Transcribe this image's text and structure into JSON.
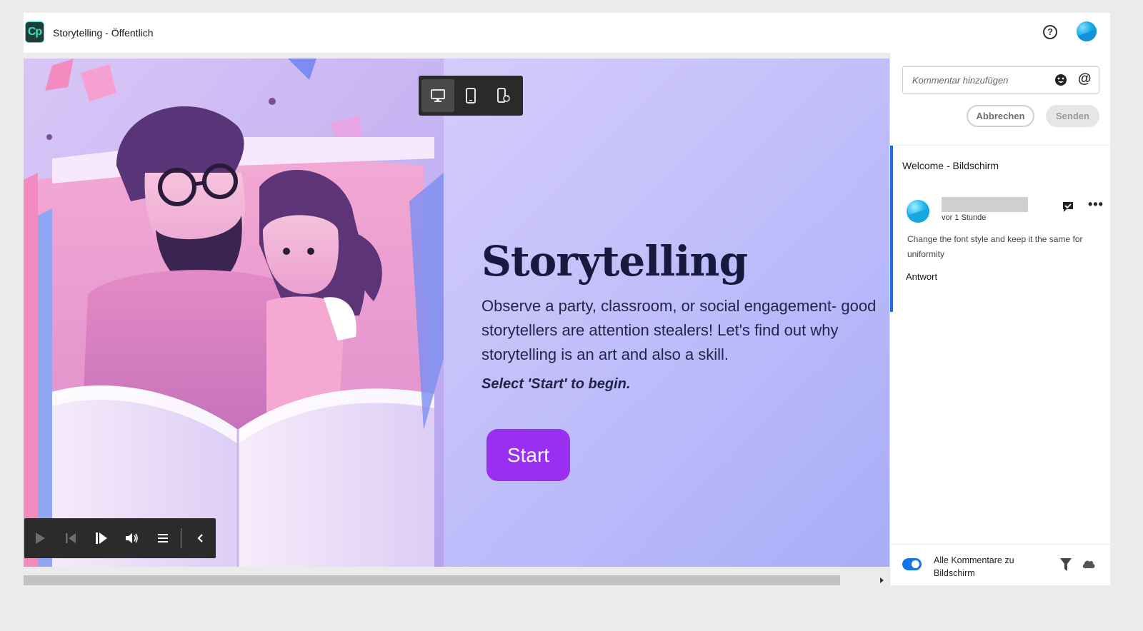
{
  "app": {
    "logo_text": "Cp",
    "title": "Storytelling - Öffentlich"
  },
  "header": {
    "help_label": "?"
  },
  "slide": {
    "title": "Storytelling",
    "body": "Observe a party, classroom, or social engagement- good storytellers are attention stealers! Let's find out why storytelling is an art and also a skill.",
    "hint": "Select 'Start' to begin.",
    "start_label": "Start"
  },
  "device_toolbar": {
    "items": [
      "desktop",
      "mobile",
      "rotate-device"
    ],
    "active": "desktop"
  },
  "player": {
    "controls": [
      "play",
      "rewind",
      "next-slide",
      "volume",
      "table-of-contents",
      "collapse"
    ]
  },
  "comments": {
    "input_placeholder": "Kommentar hinzufügen",
    "at_symbol": "@",
    "cancel_label": "Abbrechen",
    "send_label": "Senden",
    "thread": {
      "title": "Welcome - Bildschirm",
      "time": "vor 1 Stunde",
      "text": "Change the font style and keep it the same for uniformity",
      "reply_label": "Antwort"
    },
    "footer": {
      "toggle_on": true,
      "label": "Alle Kommentare zu Bildschirm"
    }
  },
  "colors": {
    "accent": "#1473e6",
    "start_button": "#9a2ff2",
    "title_text": "#18193e"
  }
}
